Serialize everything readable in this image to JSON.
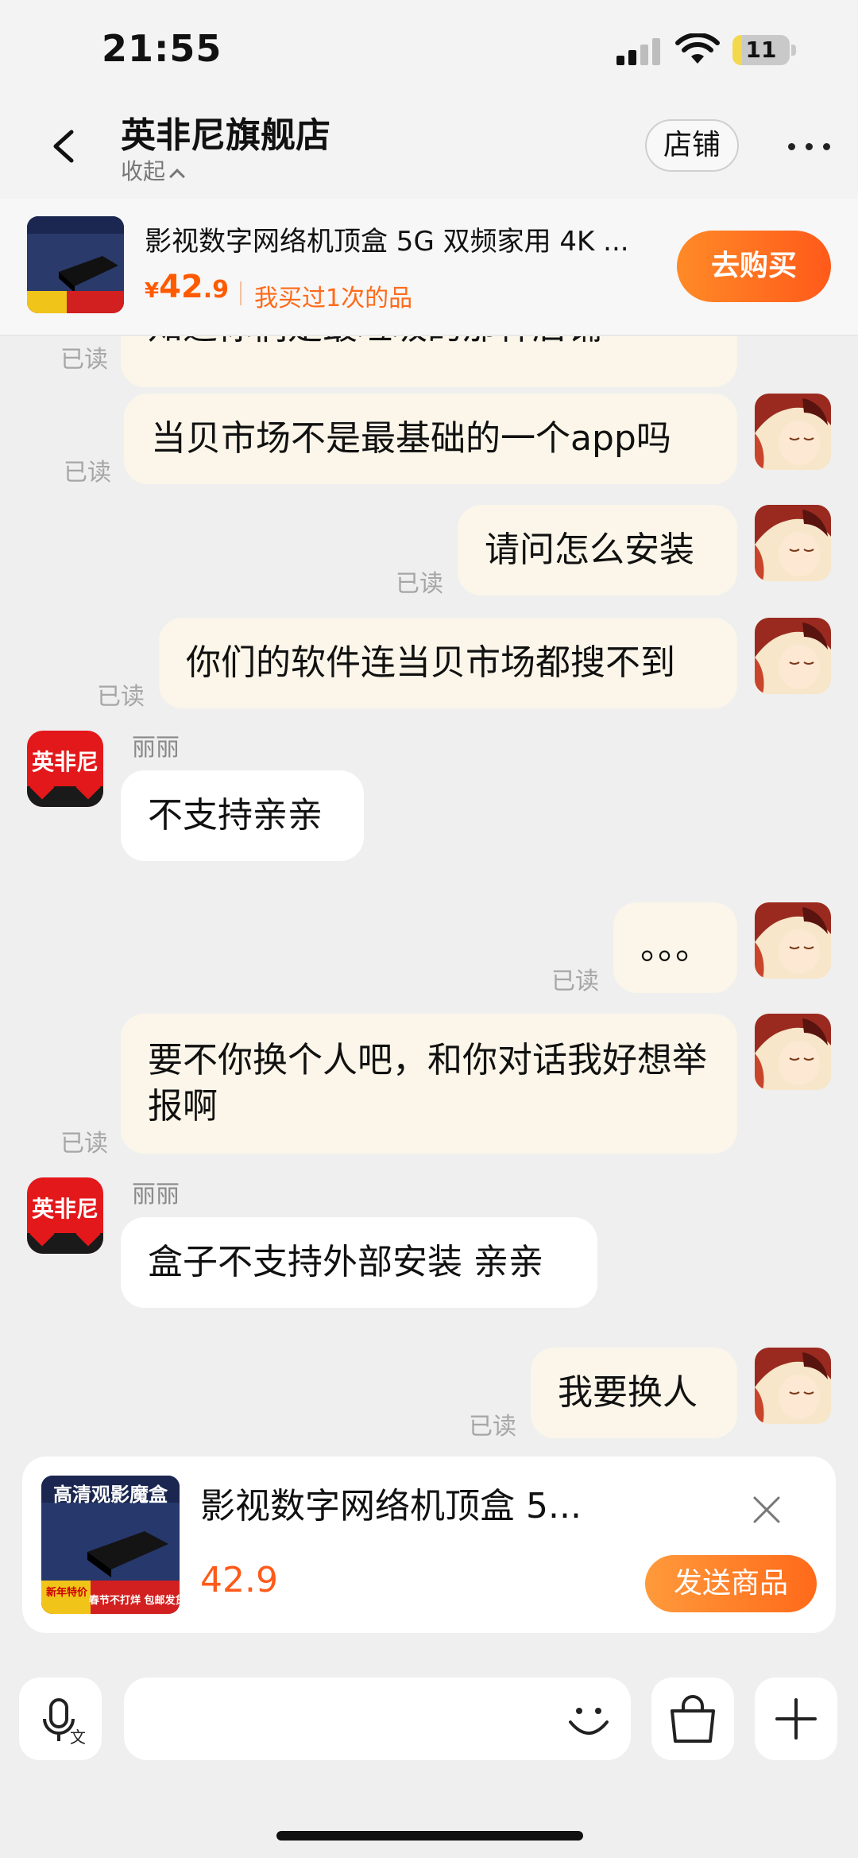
{
  "status_bar": {
    "time": "21:55",
    "battery": "11"
  },
  "header": {
    "title": "英非尼旗舰店",
    "collapse_label": "收起",
    "store_button": "店铺"
  },
  "product_bar": {
    "title": "影视数字网络机顶盒 5G 双频家用 4K ...",
    "price_currency": "¥",
    "price_int": "42",
    "price_dec": ".9",
    "bought_note": "我买过1次的品",
    "buy_button": "去购买"
  },
  "chat": {
    "read_label": "已读",
    "messages": [
      {
        "from": "me",
        "text": "知道你们是最垃圾的那种店铺"
      },
      {
        "from": "me",
        "text": "当贝市场不是最基础的一个app吗"
      },
      {
        "from": "me",
        "text": "请问怎么安装"
      },
      {
        "from": "me",
        "text": "你们的软件连当贝市场都搜不到"
      },
      {
        "from": "shop",
        "sender": "丽丽",
        "text": "不支持亲亲"
      },
      {
        "from": "me",
        "text": "。。。"
      },
      {
        "from": "me",
        "text": "要不你换个人吧，和你对话我好想举报啊"
      },
      {
        "from": "shop",
        "sender": "丽丽",
        "text": "盒子不支持外部安装 亲亲"
      },
      {
        "from": "me",
        "text": "我要换人"
      }
    ],
    "shop_avatar_label": "英非尼"
  },
  "send_card": {
    "title": "影视数字网络机顶盒 5...",
    "price": "42.9",
    "send_button": "发送商品",
    "thumb_title": "高清观影魔盒",
    "thumb_tags": [
      "新年特价",
      "春节不打烊 包邮发货"
    ]
  },
  "icons": {
    "back": "chevron-left-icon",
    "more": "more-dots-icon",
    "voice": "voice-to-text-icon",
    "emoji": "emoji-icon",
    "bag": "shopping-bag-icon",
    "plus": "plus-icon",
    "close": "close-icon"
  }
}
